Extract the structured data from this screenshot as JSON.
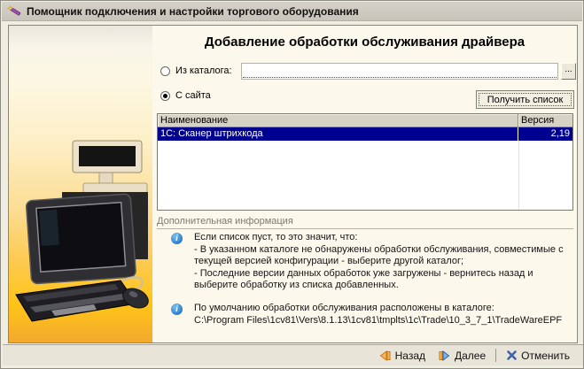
{
  "window": {
    "title": "Помощник подключения и настройки торгового оборудования",
    "title_icon": "wizard-wand-icon"
  },
  "main": {
    "heading": "Добавление обработки обслуживания драйвера",
    "source": {
      "from_catalog_label": "Из каталога:",
      "from_catalog_selected": false,
      "catalog_path_value": "",
      "browse_button_label": "...",
      "from_site_label": "С сайта",
      "from_site_selected": true
    },
    "get_list_button_label": "Получить список",
    "table": {
      "columns": [
        "Наименование",
        "Версия"
      ],
      "rows": [
        {
          "name": "1С: Сканер штрихкода",
          "version": "2,19",
          "selected": true
        }
      ]
    },
    "info_section": {
      "title": "Дополнительная информация",
      "notes": [
        {
          "icon": "info-icon",
          "lines": [
            "Если список пуст, то это значит, что:",
            "- В указанном каталоге не обнаружены обработки обслуживания, совместимые с текущей версией конфигурации - выберите другой каталог;",
            "- Последние версии данных обработок уже загружены - вернитесь назад и выберите обработку из списка добавленных."
          ]
        },
        {
          "icon": "info-icon",
          "lines": [
            "По умолчанию обработки обслуживания расположены в каталоге:",
            "C:\\Program Files\\1cv81\\Vers\\8.1.13\\1cv81\\tmplts\\1c\\Trade\\10_3_7_1\\TradeWareEPF"
          ]
        }
      ]
    }
  },
  "footer": {
    "back_label": "Назад",
    "next_label": "Далее",
    "cancel_label": "Отменить"
  },
  "colors": {
    "selection_bg": "#000090",
    "panel_bg": "#fdf8ec",
    "footer_bg": "#e9e4d8",
    "gradient_bottom": "#f3a92f",
    "info_icon_blue": "#2a78c8",
    "back_arrow_orange": "#f2a64b",
    "next_arrow_blue": "#85b2e4",
    "cancel_x_blue": "#3763ad"
  }
}
